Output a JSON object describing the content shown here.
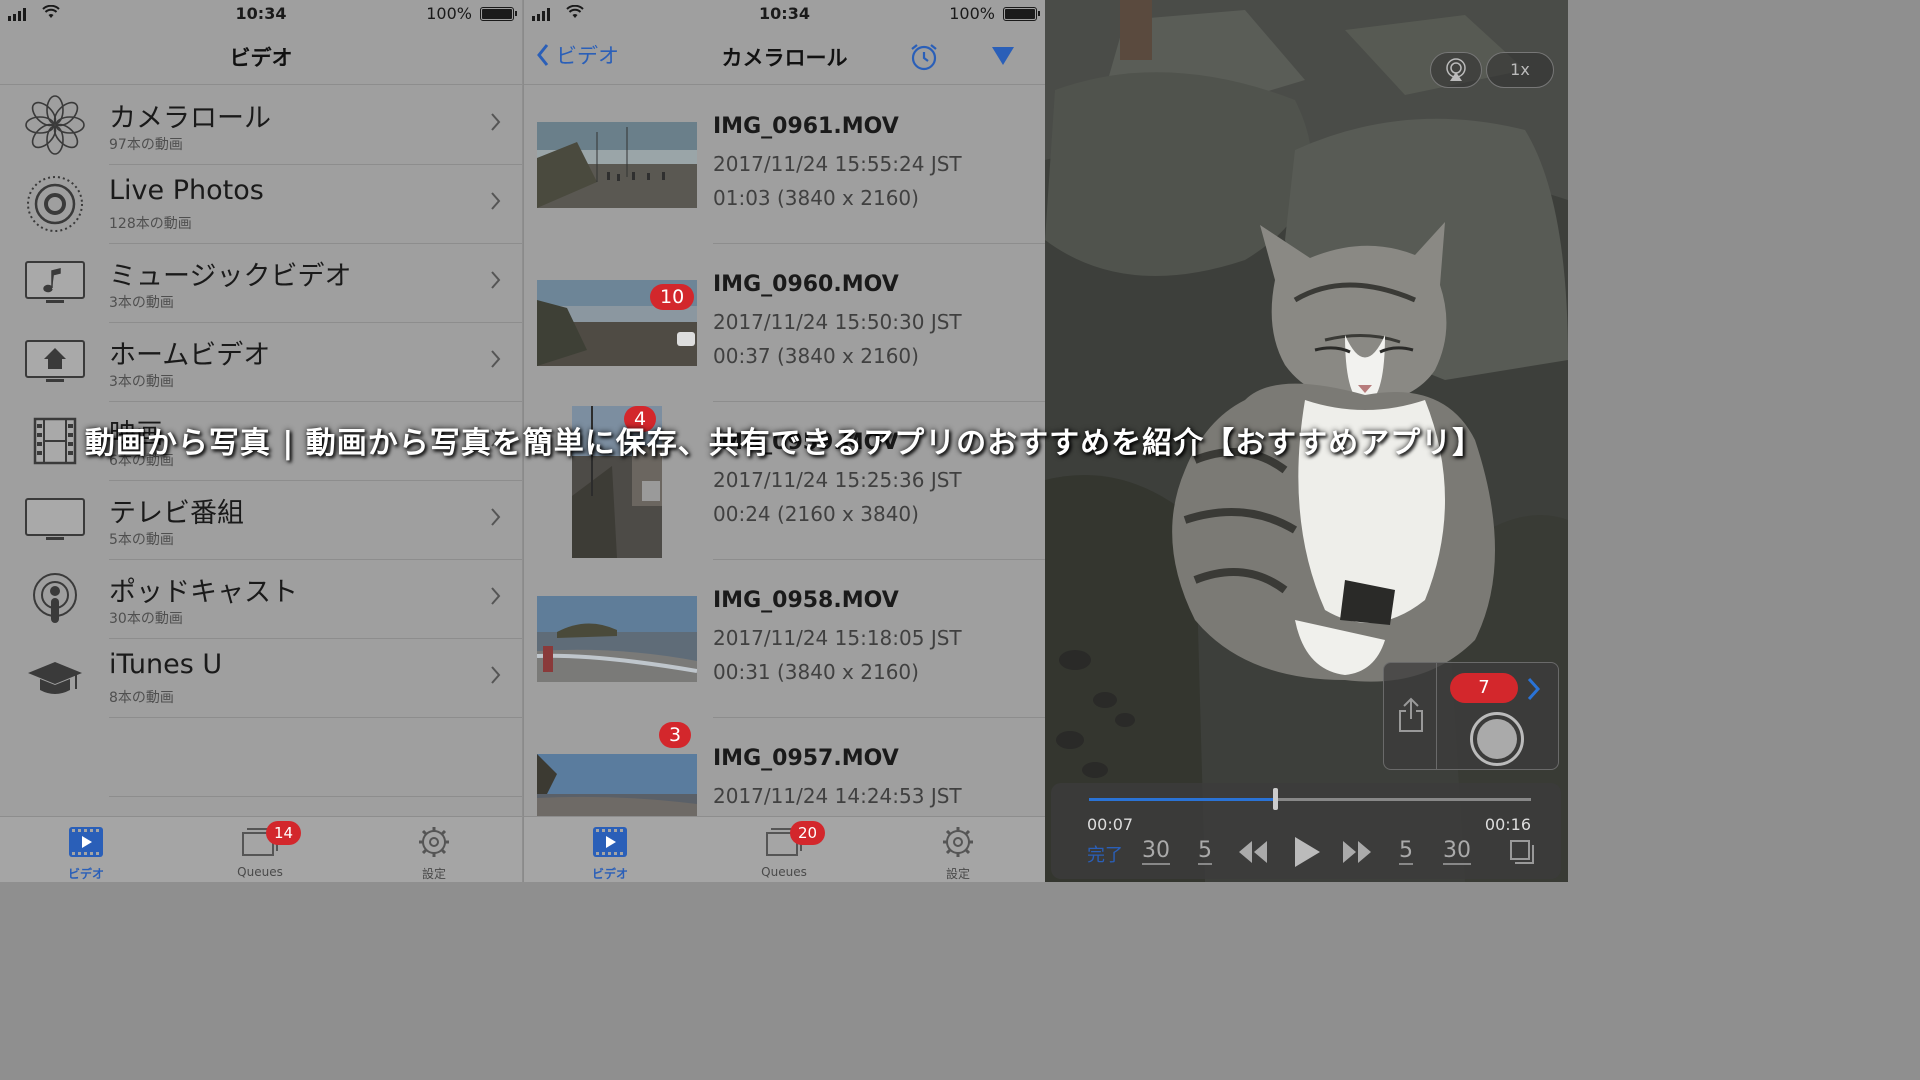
{
  "overlay_title": "動画から写真 | 動画から写真を簡単に保存、共有できるアプリのおすすめを紹介【おすすめアプリ】",
  "colors": {
    "accent": "#2a5fb8",
    "badge": "#d3272c"
  },
  "left_panel": {
    "status": {
      "time": "10:34",
      "battery": "100%"
    },
    "title": "ビデオ",
    "items": [
      {
        "label": "カメラロール",
        "count": "97本の動画",
        "icon": "flower-icon"
      },
      {
        "label": "Live Photos",
        "count": "128本の動画",
        "icon": "live-photos-icon"
      },
      {
        "label": "ミュージックビデオ",
        "count": "3本の動画",
        "icon": "music-tv-icon"
      },
      {
        "label": "ホームビデオ",
        "count": "3本の動画",
        "icon": "home-tv-icon"
      },
      {
        "label": "映画",
        "count": "6本の動画",
        "icon": "film-icon"
      },
      {
        "label": "テレビ番組",
        "count": "5本の動画",
        "icon": "tv-icon"
      },
      {
        "label": "ポッドキャスト",
        "count": "30本の動画",
        "icon": "podcast-icon"
      },
      {
        "label": "iTunes U",
        "count": "8本の動画",
        "icon": "graduation-cap-icon"
      }
    ],
    "tabs": {
      "video": "ビデオ",
      "queues": "Queues",
      "queues_badge": "14",
      "settings": "設定"
    }
  },
  "middle_panel": {
    "status": {
      "time": "10:34",
      "battery": "100%"
    },
    "back_label": "ビデオ",
    "title": "カメラロール",
    "videos": [
      {
        "name": "IMG_0961.MOV",
        "date": "2017/11/24 15:55:24 JST",
        "duration": "01:03 (3840 x 2160)",
        "badge": ""
      },
      {
        "name": "IMG_0960.MOV",
        "date": "2017/11/24 15:50:30 JST",
        "duration": "00:37 (3840 x 2160)",
        "badge": "10"
      },
      {
        "name": "IMG_0959.MOV",
        "date": "2017/11/24 15:25:36 JST",
        "duration": "00:24 (2160 x 3840)",
        "badge": "4"
      },
      {
        "name": "IMG_0958.MOV",
        "date": "2017/11/24 15:18:05 JST",
        "duration": "00:31 (3840 x 2160)",
        "badge": ""
      },
      {
        "name": "IMG_0957.MOV",
        "date": "2017/11/24 14:24:53 JST",
        "duration": "",
        "badge": "3"
      }
    ],
    "tabs": {
      "video": "ビデオ",
      "queues": "Queues",
      "queues_badge": "20",
      "settings": "設定"
    }
  },
  "right_panel": {
    "airplay_icon": "airplay-icon",
    "speed": "1x",
    "capture_count": "7",
    "time_elapsed": "00:07",
    "time_total": "00:16",
    "progress": 0.42,
    "done_label": "完了",
    "skip_back_30": "30",
    "skip_back_5": "5",
    "skip_fwd_5": "5",
    "skip_fwd_30": "30"
  }
}
